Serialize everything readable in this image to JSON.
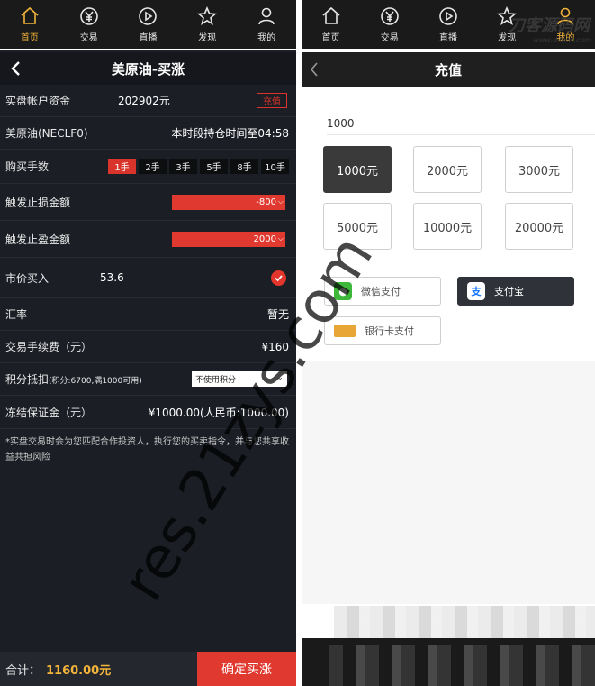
{
  "tabs": [
    {
      "label": "首页",
      "icon": "home-icon",
      "active": true
    },
    {
      "label": "交易",
      "icon": "yen-icon",
      "active": false
    },
    {
      "label": "直播",
      "icon": "play-icon",
      "active": false
    },
    {
      "label": "发现",
      "icon": "star-icon",
      "active": false
    },
    {
      "label": "我的",
      "icon": "user-icon",
      "active": false
    }
  ],
  "order": {
    "title": "美原油-买涨",
    "account_label": "实盘帐户资金",
    "account_value": "202902元",
    "recharge_button": "充值",
    "product_label": "美原油(NECLF0)",
    "product_hold": "本时段持仓时间至04:58",
    "lots_label": "购买手数",
    "lots": [
      "1手",
      "2手",
      "3手",
      "5手",
      "8手",
      "10手"
    ],
    "stop_loss_label": "触发止损金额",
    "stop_loss_value": "-800",
    "take_profit_label": "触发止盈金额",
    "take_profit_value": "2000",
    "market_buy_label": "市价买入",
    "market_buy_value": "53.6",
    "rate_label": "汇率",
    "rate_value": "暂无",
    "fee_label": "交易手续费（元）",
    "fee_value": "¥160",
    "points_label": "积分抵扣",
    "points_hint": "(积分:6700,满1000可用)",
    "points_select": "不使用积分",
    "deposit_label": "冻结保证金（元）",
    "deposit_value": "¥1000.00(人民币:1000.00)",
    "note": "*实盘交易时会为您匹配合作投资人，执行您的买卖指令，并与您共享收益共担风险",
    "total_label": "合计：",
    "total_value": "1160.00元",
    "confirm_button": "确定买涨"
  },
  "recharge": {
    "title": "充值",
    "amount_value": "1000",
    "amounts": [
      "1000元",
      "2000元",
      "3000元",
      "5000元",
      "10000元",
      "20000元"
    ],
    "selected_index": 0,
    "wechat_label": "微信支付",
    "alipay_label": "支付宝",
    "alipay_glyph": "支",
    "bank_label": "银行卡支付"
  },
  "watermark": "res.21zys.com",
  "brand": "刀客源码网",
  "brand_sub": "www.dkewl.com",
  "colors": {
    "accent": "#f2b43a",
    "danger": "#e03a30"
  }
}
